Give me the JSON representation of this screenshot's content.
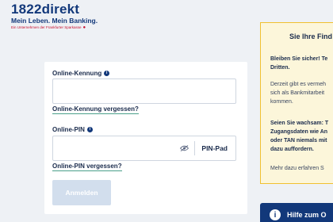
{
  "brand": {
    "name": "1822direkt",
    "slogan": "Mein Leben. Mein Banking.",
    "sub": "Ein Unternehmen der Frankfurter Sparkasse",
    "accent": "#12387a",
    "red": "#c8102e"
  },
  "login": {
    "id_label": "Online-Kennung",
    "id_value": "",
    "forgot_id": "Online-Kennung vergessen?",
    "pin_label": "Online-PIN",
    "pin_value": "",
    "pinpad_label": "PIN-Pad",
    "forgot_pin": "Online-PIN vergessen?",
    "submit_label": "Anmelden",
    "info_icon": "info-icon",
    "eye_icon": "eye-icon"
  },
  "notice": {
    "title": "Sie Ihre Find",
    "lines_1": [
      "Bleiben Sie sicher! Te",
      "Dritten."
    ],
    "lines_2": [
      "Derzeit gibt es vermeh",
      "sich als Bankmitarbeit",
      "kommen."
    ],
    "lines_3": [
      "Seien Sie wachsam: T",
      "Zugangsdaten wie An",
      "oder TAN niemals mit",
      "dazu auffordern."
    ],
    "more": "Mehr dazu erfahren S",
    "border_color": "#f0c030"
  },
  "help": {
    "label": "Hilfe zum O",
    "icon": "info-icon"
  }
}
